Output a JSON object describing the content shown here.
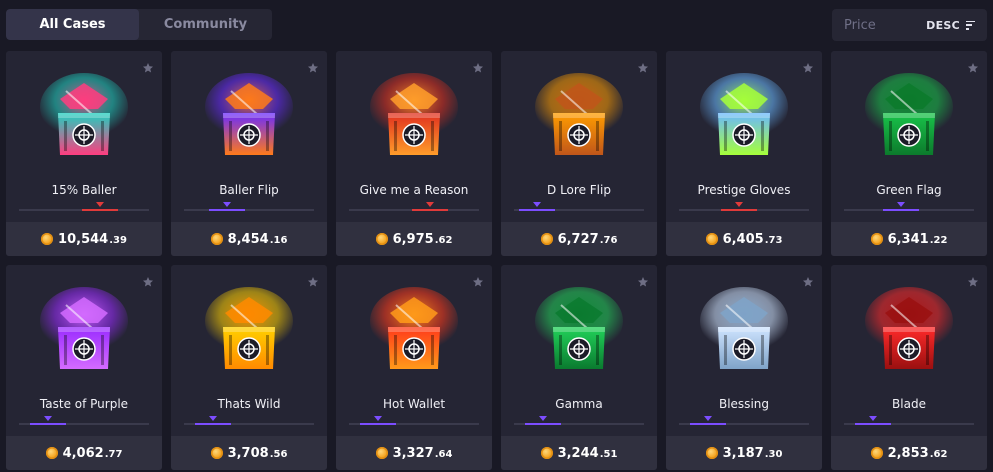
{
  "tabs": [
    {
      "label": "All Cases",
      "active": true
    },
    {
      "label": "Community",
      "active": false
    }
  ],
  "sort": {
    "label": "Price",
    "order": "DESC",
    "icon": "sort-lines-icon"
  },
  "icons": {
    "favorite": "star-icon",
    "currency": "coin-icon",
    "case_image": "case-box-icon"
  },
  "colors": {
    "background": "#191925",
    "card": "#252534",
    "price_bar": "#30303f",
    "coin": "#f5a623",
    "risk_high": "#e03a3a",
    "risk_low": "#7c4dff"
  },
  "cases": [
    {
      "name": "15% Baller",
      "price_main": "10,544",
      "price_decimal": ".39",
      "risk_level": "high",
      "risk_position": 0.62,
      "theme_colors": [
        "#1fd0c0",
        "#ff3d7f"
      ]
    },
    {
      "name": "Baller Flip",
      "price_main": "8,454",
      "price_decimal": ".16",
      "risk_level": "low",
      "risk_position": 0.33,
      "theme_colors": [
        "#6a2cff",
        "#ff7a1a"
      ]
    },
    {
      "name": "Give me a Reason",
      "price_main": "6,975",
      "price_decimal": ".62",
      "risk_level": "high",
      "risk_position": 0.62,
      "theme_colors": [
        "#e0301f",
        "#ff9d2a"
      ]
    },
    {
      "name": "D Lore Flip",
      "price_main": "6,727",
      "price_decimal": ".76",
      "risk_level": "low",
      "risk_position": 0.18,
      "theme_colors": [
        "#ff9d00",
        "#c0561a"
      ]
    },
    {
      "name": "Prestige Gloves",
      "price_main": "6,405",
      "price_decimal": ".73",
      "risk_level": "high",
      "risk_position": 0.46,
      "theme_colors": [
        "#6ab8ff",
        "#a6ff3a"
      ]
    },
    {
      "name": "Green Flag",
      "price_main": "6,341",
      "price_decimal": ".22",
      "risk_level": "low",
      "risk_position": 0.44,
      "theme_colors": [
        "#19c34a",
        "#0c7a2c"
      ]
    },
    {
      "name": "Taste of Purple",
      "price_main": "4,062",
      "price_decimal": ".77",
      "risk_level": "low",
      "risk_position": 0.22,
      "theme_colors": [
        "#9a2cff",
        "#d46bff"
      ]
    },
    {
      "name": "Thats Wild",
      "price_main": "3,708",
      "price_decimal": ".56",
      "risk_level": "low",
      "risk_position": 0.22,
      "theme_colors": [
        "#ffd100",
        "#ff8a00"
      ]
    },
    {
      "name": "Hot Wallet",
      "price_main": "3,327",
      "price_decimal": ".64",
      "risk_level": "low",
      "risk_position": 0.22,
      "theme_colors": [
        "#ff3a1a",
        "#ff9a1a"
      ]
    },
    {
      "name": "Gamma",
      "price_main": "3,244",
      "price_decimal": ".51",
      "risk_level": "low",
      "risk_position": 0.22,
      "theme_colors": [
        "#22d25a",
        "#0a7a2f"
      ]
    },
    {
      "name": "Blessing",
      "price_main": "3,187",
      "price_decimal": ".30",
      "risk_level": "low",
      "risk_position": 0.22,
      "theme_colors": [
        "#cfe4ff",
        "#7fa3c8"
      ]
    },
    {
      "name": "Blade",
      "price_main": "2,853",
      "price_decimal": ".62",
      "risk_level": "low",
      "risk_position": 0.22,
      "theme_colors": [
        "#ff2a2a",
        "#9a1010"
      ]
    }
  ]
}
